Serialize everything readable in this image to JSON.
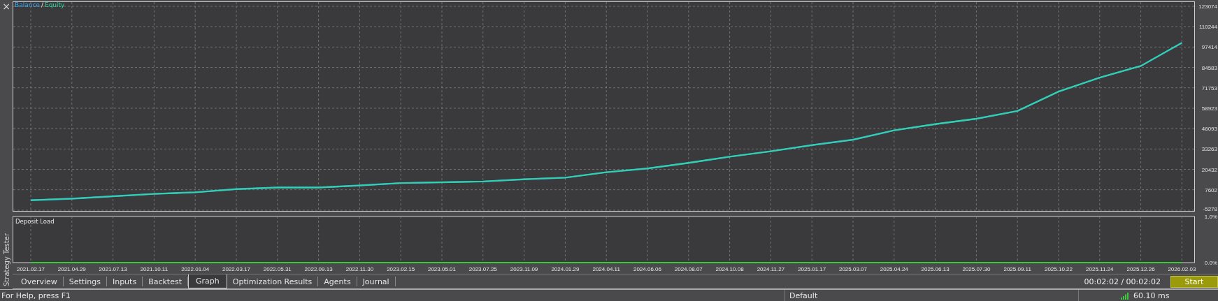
{
  "panel": {
    "title": "Strategy Tester",
    "close": "×"
  },
  "graph": {
    "legend_separator": "/",
    "chart_data": {
      "type": "line",
      "grid": true,
      "ylim": [
        -5278,
        123074
      ],
      "yticks": [
        -5278,
        7602,
        20432,
        33263,
        46093,
        58923,
        71753,
        84583,
        97414,
        110244,
        123074
      ],
      "series": [
        {
          "name": "Balance",
          "color": "#3aa8f0",
          "values": [
            1000,
            2000,
            3500,
            5000,
            6000,
            8000,
            9000,
            9000,
            10300,
            11800,
            12300,
            12800,
            14200,
            15200,
            18600,
            21000,
            24500,
            28400,
            31800,
            35700,
            39100,
            45000,
            48900,
            52300,
            57200,
            69400,
            78200,
            85500,
            100100
          ]
        },
        {
          "name": "Equity",
          "color": "#2fd6a0",
          "values": [
            1000,
            2000,
            3500,
            5000,
            6000,
            8000,
            9000,
            9000,
            10300,
            11800,
            12300,
            12800,
            14200,
            15200,
            18600,
            21000,
            24500,
            28400,
            31800,
            35700,
            39100,
            45000,
            48900,
            52300,
            57200,
            69400,
            78200,
            85500,
            100100
          ]
        }
      ]
    }
  },
  "deposit_load": {
    "chart_data": {
      "type": "line",
      "grid": true,
      "ylim": [
        0,
        1
      ],
      "yticks": [
        {
          "value": 0,
          "label": "0.0%"
        },
        {
          "value": 1,
          "label": "1.0%"
        }
      ],
      "categories": [
        "2021.02.17",
        "2021.04.29",
        "2021.07.13",
        "2021.10.11",
        "2022.01.04",
        "2022.03.17",
        "2022.05.31",
        "2022.09.13",
        "2022.11.30",
        "2023.02.15",
        "2023.05.01",
        "2023.07.25",
        "2023.11.09",
        "2024.01.29",
        "2024.04.11",
        "2024.06.06",
        "2024.08.07",
        "2024.10.08",
        "2024.11.27",
        "2025.01.17",
        "2025.03.07",
        "2025.04.24",
        "2025.06.13",
        "2025.07.30",
        "2025.09.11",
        "2025.10.22",
        "2025.11.24",
        "2025.12.26",
        "2026.02.03"
      ],
      "series": [
        {
          "name": "Deposit Load",
          "color": "#3cc83c",
          "values": [
            0,
            0,
            0,
            0,
            0,
            0,
            0,
            0,
            0,
            0,
            0,
            0,
            0,
            0,
            0,
            0,
            0,
            0,
            0,
            0,
            0,
            0,
            0,
            0,
            0,
            0,
            0,
            0,
            0
          ]
        }
      ]
    }
  },
  "tabs": [
    {
      "label": "Overview",
      "selected": false
    },
    {
      "label": "Settings",
      "selected": false
    },
    {
      "label": "Inputs",
      "selected": false
    },
    {
      "label": "Backtest",
      "selected": false
    },
    {
      "label": "Graph",
      "selected": true
    },
    {
      "label": "Optimization Results",
      "selected": false
    },
    {
      "label": "Agents",
      "selected": false
    },
    {
      "label": "Journal",
      "selected": false
    }
  ],
  "elapsed": "00:02:02 / 00:02:02",
  "start_button": "Start",
  "status_bar": {
    "help": "For Help, press F1",
    "profile": "Default",
    "ping": "60.10 ms"
  }
}
